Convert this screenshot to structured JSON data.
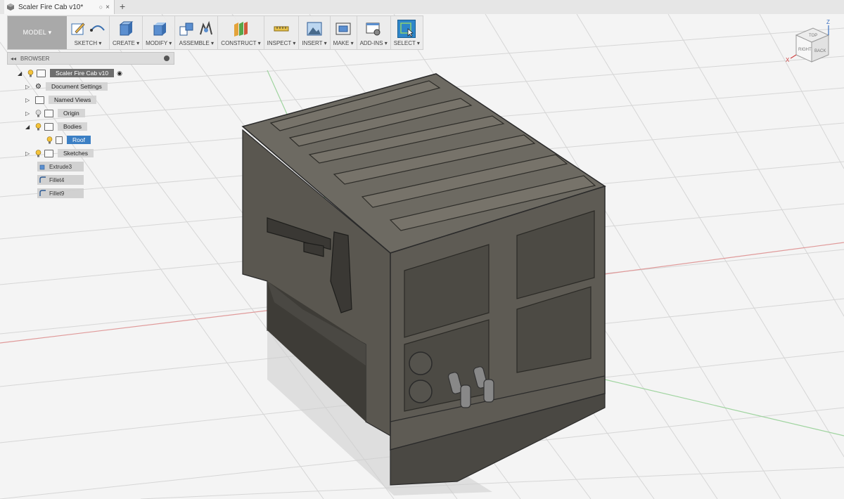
{
  "tab": {
    "title": "Scaler Fire Cab v10*",
    "close": "×",
    "new_tab": "+"
  },
  "toolbar": {
    "workspace": "MODEL ▾",
    "groups": [
      {
        "label": "SKETCH ▾"
      },
      {
        "label": "CREATE ▾"
      },
      {
        "label": "MODIFY ▾"
      },
      {
        "label": "ASSEMBLE ▾"
      },
      {
        "label": "CONSTRUCT ▾"
      },
      {
        "label": "INSPECT ▾"
      },
      {
        "label": "INSERT ▾"
      },
      {
        "label": "MAKE ▾"
      },
      {
        "label": "ADD-INS ▾"
      },
      {
        "label": "SELECT ▾"
      }
    ]
  },
  "browser": {
    "title": "BROWSER",
    "root": "Scaler Fire Cab v10",
    "items": [
      {
        "label": "Document Settings"
      },
      {
        "label": "Named Views"
      },
      {
        "label": "Origin"
      },
      {
        "label": "Bodies"
      },
      {
        "label": "Roof"
      },
      {
        "label": "Sketches"
      }
    ],
    "timeline": [
      "Extrude3",
      "Fillet4",
      "Fillet9"
    ]
  },
  "viewcube": {
    "top": "TOP",
    "front": "RIGHT",
    "back": "BACK",
    "axis_x": "X",
    "axis_z": "Z"
  }
}
